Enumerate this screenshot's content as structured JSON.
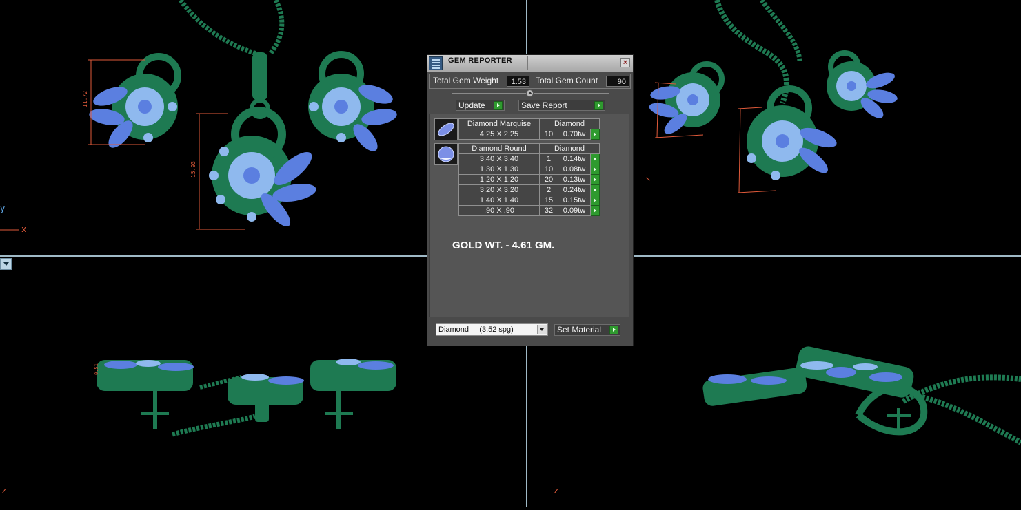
{
  "viewports": {
    "top_left": {
      "axis_y": "y",
      "axis_x": "x",
      "dim_1": "11.72",
      "dim_2": "15.93"
    },
    "bottom_left": {
      "axis_z": "z",
      "dim_1": "0.51"
    },
    "bottom_right": {
      "axis_z": "z"
    }
  },
  "colors": {
    "metal": "#1e7a52",
    "gem": "#5b7fe0",
    "gem_small": "#8fb9ee",
    "dimension": "#e05a3a",
    "divider": "#9fb9c6"
  },
  "dialog": {
    "title": "GEM REPORTER",
    "close_icon": "×",
    "total_gem_weight_label": "Total Gem Weight",
    "total_gem_weight_value": "1.53",
    "total_gem_count_label": "Total Gem Count",
    "total_gem_count_value": "90",
    "update_label": "Update",
    "save_report_label": "Save Report",
    "gem_groups": [
      {
        "shape": "Diamond Marquise",
        "material": "Diamond",
        "rows": [
          {
            "size": "4.25 X 2.25",
            "count": "10",
            "weight": "0.70tw"
          }
        ]
      },
      {
        "shape": "Diamond Round",
        "material": "Diamond",
        "rows": [
          {
            "size": "3.40 X 3.40",
            "count": "1",
            "weight": "0.14tw"
          },
          {
            "size": "1.30 X 1.30",
            "count": "10",
            "weight": "0.08tw"
          },
          {
            "size": "1.20 X 1.20",
            "count": "20",
            "weight": "0.13tw"
          },
          {
            "size": "3.20 X 3.20",
            "count": "2",
            "weight": "0.24tw"
          },
          {
            "size": "1.40 X 1.40",
            "count": "15",
            "weight": "0.15tw"
          },
          {
            "size": ".90 X .90",
            "count": "32",
            "weight": "0.09tw"
          }
        ]
      }
    ],
    "gold_note": "GOLD WT. - 4.61 GM.",
    "material_select": {
      "value": "Diamond     (3.52 spg)"
    },
    "set_material_label": "Set Material"
  }
}
